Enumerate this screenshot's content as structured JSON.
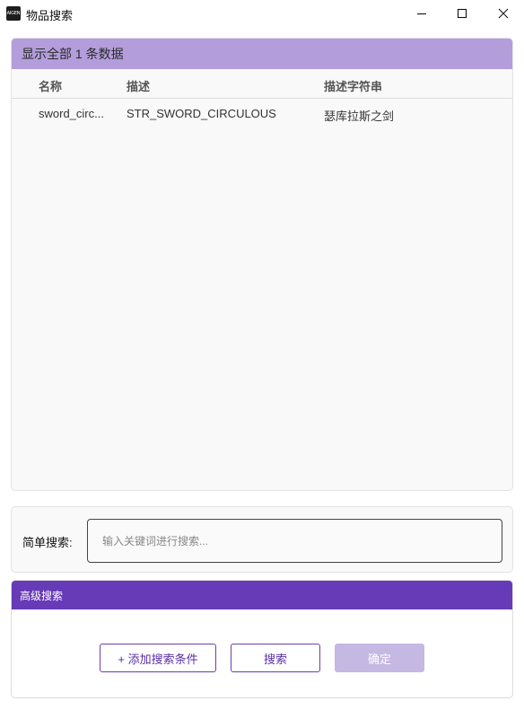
{
  "window": {
    "title": "物品搜索",
    "icon_text": "AIGEN",
    "minimize_icon": "minimize-icon",
    "maximize_icon": "maximize-icon",
    "close_icon": "close-icon"
  },
  "results": {
    "header": "显示全部 1 条数据",
    "columns": [
      "名称",
      "描述",
      "描述字符串"
    ],
    "rows": [
      {
        "name": "sword_circ...",
        "desc": "STR_SWORD_CIRCULOUS",
        "desc_string": "瑟库拉斯之剑"
      }
    ]
  },
  "simple_search": {
    "label": "简单搜索:",
    "placeholder": "输入关键词进行搜索..."
  },
  "advanced_search": {
    "header": "高级搜索",
    "add_condition_label": "+ 添加搜索条件",
    "search_label": "搜索",
    "confirm_label": "确定"
  },
  "colors": {
    "results_header_bg": "#b39ddb",
    "advanced_header_bg": "#673ab7",
    "button_border": "#6a3fb0",
    "confirm_disabled_bg": "#c5b8e3"
  }
}
